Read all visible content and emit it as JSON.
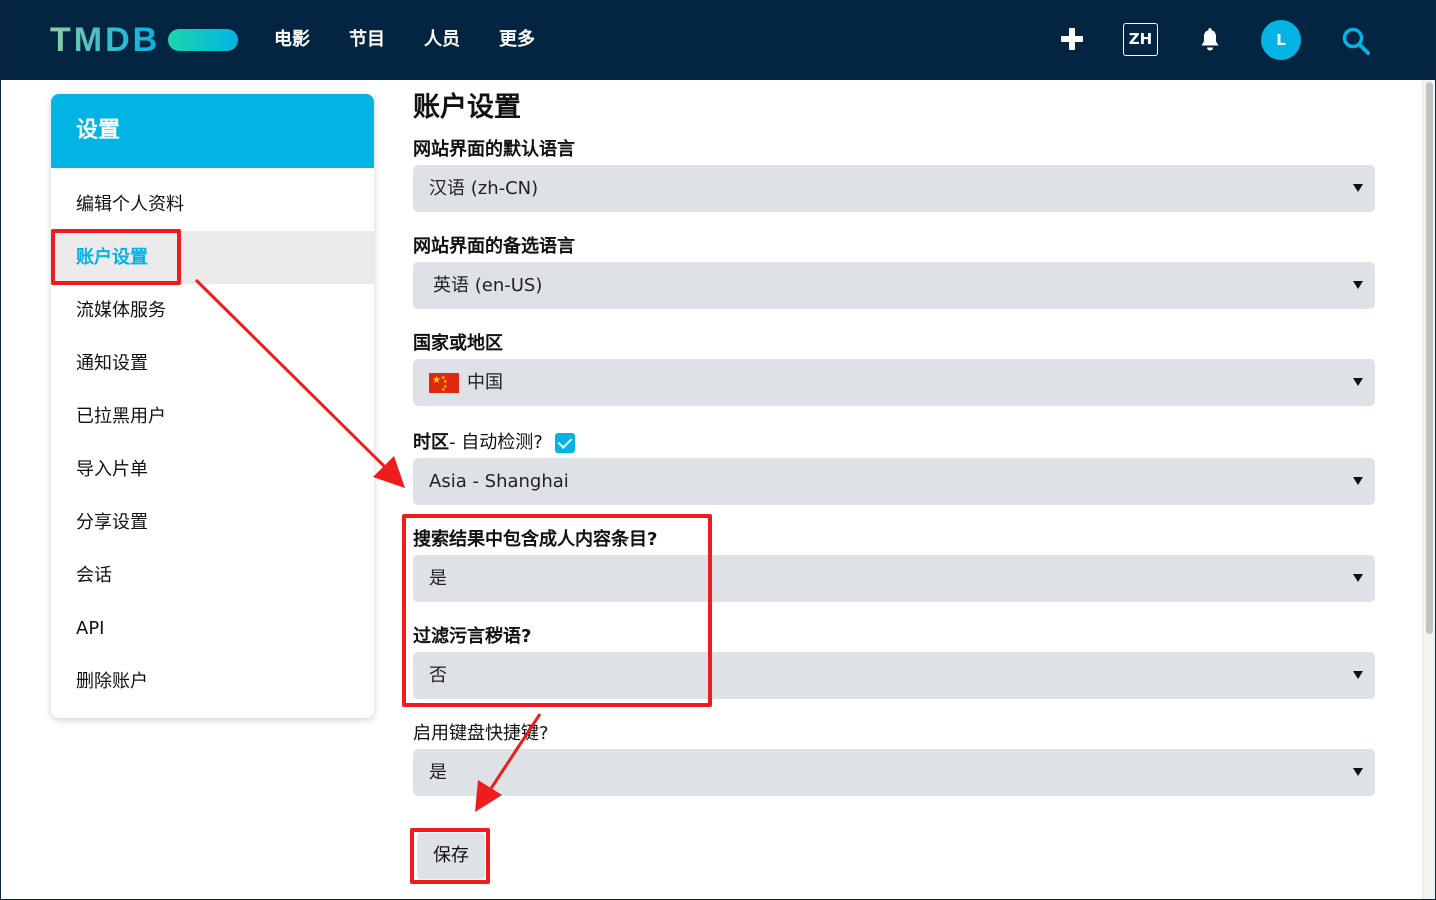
{
  "header": {
    "logo_text": "TMDB",
    "nav": [
      "电影",
      "节目",
      "人员",
      "更多"
    ],
    "lang": "ZH",
    "avatar_letter": "L"
  },
  "sidebar": {
    "title": "设置",
    "items": [
      {
        "label": "编辑个人资料",
        "active": false
      },
      {
        "label": "账户设置",
        "active": true
      },
      {
        "label": "流媒体服务",
        "active": false
      },
      {
        "label": "通知设置",
        "active": false
      },
      {
        "label": "已拉黑用户",
        "active": false
      },
      {
        "label": "导入片单",
        "active": false
      },
      {
        "label": "分享设置",
        "active": false
      },
      {
        "label": "会话",
        "active": false
      },
      {
        "label": "API",
        "active": false
      },
      {
        "label": "删除账户",
        "active": false
      }
    ]
  },
  "main": {
    "title": "账户设置",
    "fields": {
      "default_lang": {
        "label": "网站界面的默认语言",
        "value": "汉语 (zh-CN)"
      },
      "fallback_lang": {
        "label": "网站界面的备选语言",
        "value": "英语 (en-US)"
      },
      "country": {
        "label": "国家或地区",
        "value": "中国"
      },
      "timezone": {
        "label": "时区",
        "auto_label": " - 自动检测?",
        "auto_checked": true,
        "value": "Asia - Shanghai"
      },
      "adult": {
        "label": "搜索结果中包含成人内容条目?",
        "value": "是"
      },
      "profanity": {
        "label": "过滤污言秽语?",
        "value": "否"
      },
      "shortcuts": {
        "label": "启用键盘快捷键?",
        "value": "是"
      }
    },
    "save_label": "保存"
  },
  "colors": {
    "header_bg": "#032541",
    "accent": "#01b4e4",
    "annotation": "#ee1c1c"
  }
}
